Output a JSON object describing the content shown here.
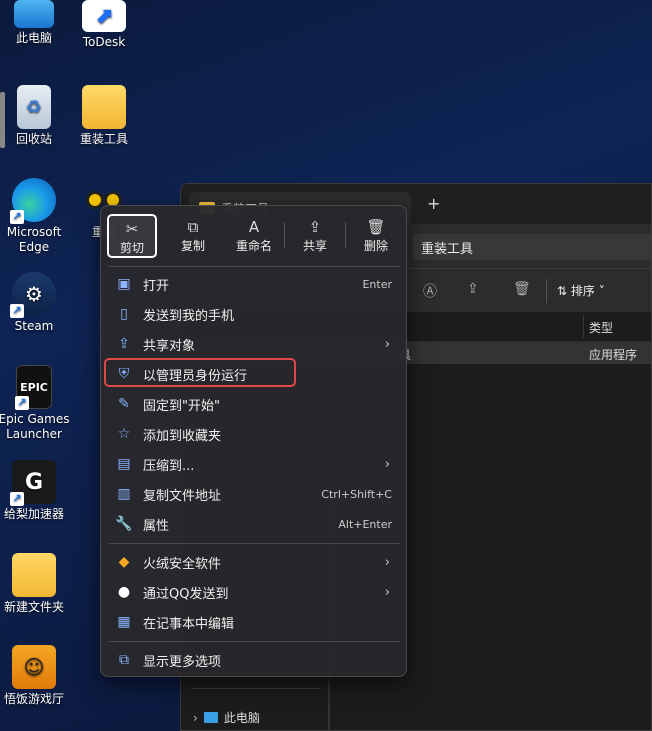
{
  "desktop": {
    "icons": [
      {
        "label": "此电脑",
        "name": "this-pc"
      },
      {
        "label": "ToDesk",
        "name": "todesk"
      },
      {
        "label": "回收站",
        "name": "recycle-bin"
      },
      {
        "label": "重装工具",
        "name": "reinstall-tool"
      },
      {
        "label": "Microsoft Edge",
        "name": "edge"
      },
      {
        "label": "重装",
        "name": "reinstall-app"
      },
      {
        "label": "Steam",
        "name": "steam"
      },
      {
        "label": "Epic Games Launcher",
        "name": "epic"
      },
      {
        "label": "给梨加速器",
        "name": "geili-accelerator"
      },
      {
        "label": "新建文件夹",
        "name": "new-folder"
      },
      {
        "label": "悟饭游戏厅",
        "name": "wufan-game"
      }
    ]
  },
  "explorer": {
    "tab_title": "重装工具",
    "new_tab": "+",
    "breadcrumb": "重装工具",
    "sort_label": "排序",
    "column_type": "类型",
    "row_name_suffix": "具",
    "row_type": "应用程序",
    "sidebar_this_pc": "此电脑"
  },
  "context_menu": {
    "quick_actions": [
      {
        "label": "剪切",
        "icon": "cut-icon",
        "glyph": "✂"
      },
      {
        "label": "复制",
        "icon": "copy-icon",
        "glyph": "⧉"
      },
      {
        "label": "重命名",
        "icon": "rename-icon",
        "glyph": "A"
      },
      {
        "label": "共享",
        "icon": "share-icon",
        "glyph": "⇪"
      },
      {
        "label": "删除",
        "icon": "delete-icon",
        "glyph": "🗑"
      }
    ],
    "items": [
      {
        "label": "打开",
        "shortcut": "Enter",
        "icon": "open-icon",
        "glyph": "▣"
      },
      {
        "label": "发送到我的手机",
        "shortcut": "",
        "icon": "phone-icon",
        "glyph": "▯"
      },
      {
        "label": "共享对象",
        "shortcut": "",
        "icon": "share-with-icon",
        "glyph": "⇪"
      },
      {
        "label": "以管理员身份运行",
        "shortcut": "",
        "icon": "admin-shield-icon",
        "glyph": "⛨"
      },
      {
        "label": "固定到\"开始\"",
        "shortcut": "",
        "icon": "pin-icon",
        "glyph": "✎"
      },
      {
        "label": "添加到收藏夹",
        "shortcut": "",
        "icon": "star-icon",
        "glyph": "☆"
      },
      {
        "label": "压缩到...",
        "shortcut": "",
        "icon": "zip-icon",
        "glyph": "▤"
      },
      {
        "label": "复制文件地址",
        "shortcut": "Ctrl+Shift+C",
        "icon": "copy-path-icon",
        "glyph": "▥"
      },
      {
        "label": "属性",
        "shortcut": "Alt+Enter",
        "icon": "wrench-icon",
        "glyph": "🔧"
      },
      {
        "label": "火绒安全软件",
        "shortcut": "",
        "icon": "huorong-icon",
        "glyph": "◆"
      },
      {
        "label": "通过QQ发送到",
        "shortcut": "",
        "icon": "qq-icon",
        "glyph": "●"
      },
      {
        "label": "在记事本中编辑",
        "shortcut": "",
        "icon": "notepad-icon",
        "glyph": "▦"
      },
      {
        "label": "显示更多选项",
        "shortcut": "",
        "icon": "more-options-icon",
        "glyph": "⧉"
      }
    ],
    "submenu_arrow": "›",
    "accent_color": "#e04848"
  }
}
